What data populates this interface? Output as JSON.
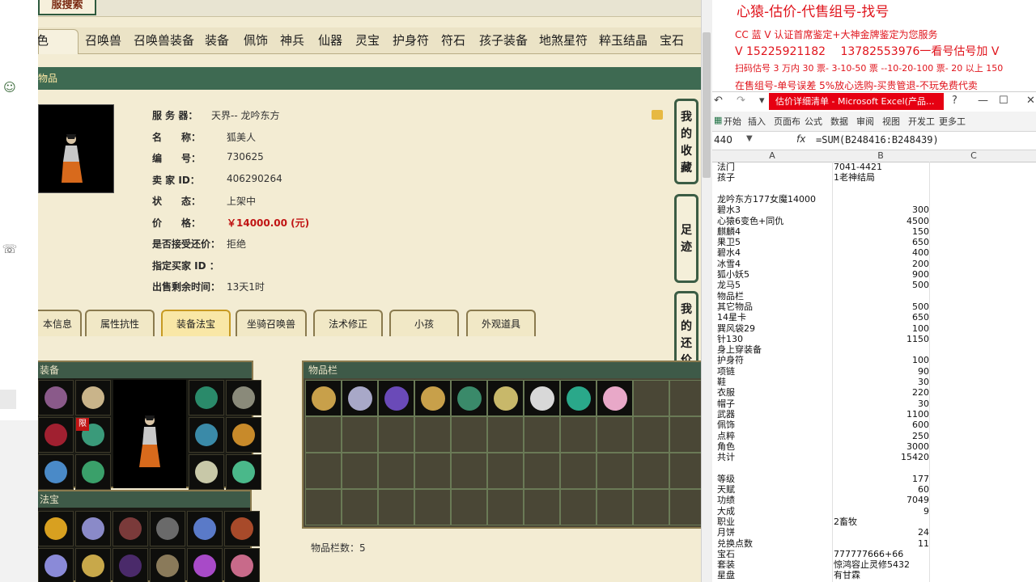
{
  "game": {
    "logo_text": "服搜索",
    "nav_tabs": [
      "色",
      "召唤兽",
      "召唤兽装备",
      "装备",
      "佩饰",
      "神兵",
      "仙器",
      "灵宝",
      "护身符",
      "符石",
      "孩子装备",
      "地煞星符",
      "粹玉结晶",
      "宝石"
    ],
    "section_title": "物品",
    "info": {
      "server_label": "服 务 器：",
      "server_value": "天界-- 龙吟东方",
      "name_label": "名　　称：",
      "name_value": "狐美人",
      "id_label": "编　　号：",
      "id_value": "730625",
      "seller_label": "卖 家 ID：",
      "seller_value": "406290264",
      "status_label": "状　　态：",
      "status_value": "上架中",
      "price_label": "价　　格：",
      "price_value": "￥14000.00 (元)",
      "counter_label": "是否接受还价：",
      "counter_value": "拒绝",
      "buyer_label": "指定买家 ID ：",
      "buyer_value": "",
      "remaining_label": "出售剩余时间：",
      "remaining_value": "13天1时"
    },
    "side_buttons": [
      "我的收藏",
      "足迹",
      "我的还价"
    ],
    "sub_tabs": [
      "本信息",
      "属性抗性",
      "装备法宝",
      "坐骑召唤兽",
      "法术修正",
      "小孩",
      "外观道具"
    ],
    "active_sub_tab": "装备法宝",
    "equip_panel_title": "装备",
    "limit_badge": "限",
    "treasure_panel_title": "法宝",
    "inventory_panel_title": "物品栏",
    "inventory_count": "物品栏数：5"
  },
  "promo": {
    "line1": "心猿-估价-代售组号-找号",
    "line2": "CC 蓝 V 认证首席鉴定+大神金牌鉴定为您服务",
    "line3": "V 15225921182　 13782553976一看号估号加 V",
    "line4": "扫码估号 3 万内 30 票- 3-10-50 票 --10-20-100 票- 20 以上 150",
    "line5": "在售组号-单号误差 5%放心选购-买贵管退-不玩免费代卖"
  },
  "excel": {
    "title": "估价详细清单 - Microsoft Excel(产品...",
    "ribbon": [
      "开始",
      "插入",
      "页面布",
      "公式",
      "数据",
      "审阅",
      "视图",
      "开发工",
      "更多工"
    ],
    "name_box": "440",
    "fx": "fx",
    "formula": "=SUM(B248416:B248439)",
    "columns": [
      "A",
      "B",
      "C"
    ],
    "rows": [
      {
        "a": "法门",
        "b": "7041-4421",
        "n": false
      },
      {
        "a": "孩子",
        "b": "1老神结局",
        "n": false
      },
      {
        "a": "",
        "b": "",
        "n": false
      },
      {
        "a": "龙吟东方177女魔14000",
        "b": "",
        "n": false
      },
      {
        "a": "碧水3",
        "b": "300",
        "n": true
      },
      {
        "a": "心猿6变色+同仇",
        "b": "4500",
        "n": true
      },
      {
        "a": "麒麟4",
        "b": "150",
        "n": true
      },
      {
        "a": "果卫5",
        "b": "650",
        "n": true
      },
      {
        "a": "碧水4",
        "b": "400",
        "n": true
      },
      {
        "a": "冰雪4",
        "b": "200",
        "n": true
      },
      {
        "a": "狐小妖5",
        "b": "900",
        "n": true
      },
      {
        "a": "龙马5",
        "b": "500",
        "n": true
      },
      {
        "a": "物品栏",
        "b": "",
        "n": false
      },
      {
        "a": "其它物品",
        "b": "500",
        "n": true
      },
      {
        "a": "14星卡",
        "b": "650",
        "n": true
      },
      {
        "a": "巽风袋29",
        "b": "100",
        "n": true
      },
      {
        "a": "针130",
        "b": "1150",
        "n": true
      },
      {
        "a": "身上穿装备",
        "b": "",
        "n": false
      },
      {
        "a": "护身符",
        "b": "100",
        "n": true
      },
      {
        "a": "项链",
        "b": "90",
        "n": true
      },
      {
        "a": "鞋",
        "b": "30",
        "n": true
      },
      {
        "a": "衣服",
        "b": "220",
        "n": true
      },
      {
        "a": "帽子",
        "b": "30",
        "n": true
      },
      {
        "a": "武器",
        "b": "1100",
        "n": true
      },
      {
        "a": "佩饰",
        "b": "600",
        "n": true
      },
      {
        "a": "点粹",
        "b": "250",
        "n": true
      },
      {
        "a": "角色",
        "b": "3000",
        "n": true
      },
      {
        "a": "共计",
        "b": "15420",
        "n": true
      },
      {
        "a": "",
        "b": "",
        "n": false
      },
      {
        "a": "等级",
        "b": "177",
        "n": true
      },
      {
        "a": "天赋",
        "b": "60",
        "n": true
      },
      {
        "a": "功绩",
        "b": "7049",
        "n": true
      },
      {
        "a": "大成",
        "b": "9",
        "n": true
      },
      {
        "a": "职业",
        "b": "2畜牧",
        "n": false
      },
      {
        "a": "月饼",
        "b": "24",
        "n": true
      },
      {
        "a": "兑换点数",
        "b": "11",
        "n": true
      },
      {
        "a": "宝石",
        "b": "777777666+66",
        "n": false
      },
      {
        "a": "套装",
        "b": "惊鸿容止灵修5432",
        "n": false
      },
      {
        "a": "星盘",
        "b": "有甘霖",
        "n": false
      }
    ]
  },
  "colors": {
    "accent_green": "#3e6a52",
    "price_red": "#c01414",
    "promo_red": "#e0141c",
    "excel_red": "#e60012"
  }
}
